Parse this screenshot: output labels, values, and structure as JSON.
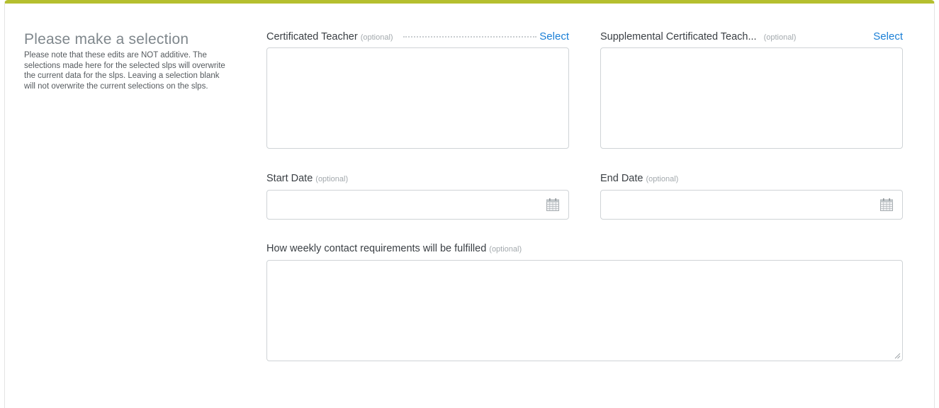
{
  "intro": {
    "title": "Please make a selection",
    "note": "Please note that these edits are NOT additive. The selections made here for the selected slps will overwrite the current data for the slps. Leaving a selection blank will not overwrite the current selections on the slps."
  },
  "fields": {
    "certificated_teacher": {
      "label": "Certificated Teacher",
      "optional": "(optional)",
      "action": "Select"
    },
    "supplemental_teacher": {
      "label": "Supplemental Certificated Teach...",
      "optional": "(optional)",
      "action": "Select"
    },
    "start_date": {
      "label": "Start Date",
      "optional": "(optional)",
      "value": ""
    },
    "end_date": {
      "label": "End Date",
      "optional": "(optional)",
      "value": ""
    },
    "weekly_contact": {
      "label": "How weekly contact requirements will be fulfilled",
      "optional": "(optional)",
      "value": ""
    }
  },
  "icons": {
    "calendar": "calendar-icon",
    "resize": "resize-grip-icon"
  },
  "colors": {
    "accent_bar": "#b5bf2f",
    "link": "#1a7fd6",
    "border": "#cfd3d6"
  }
}
